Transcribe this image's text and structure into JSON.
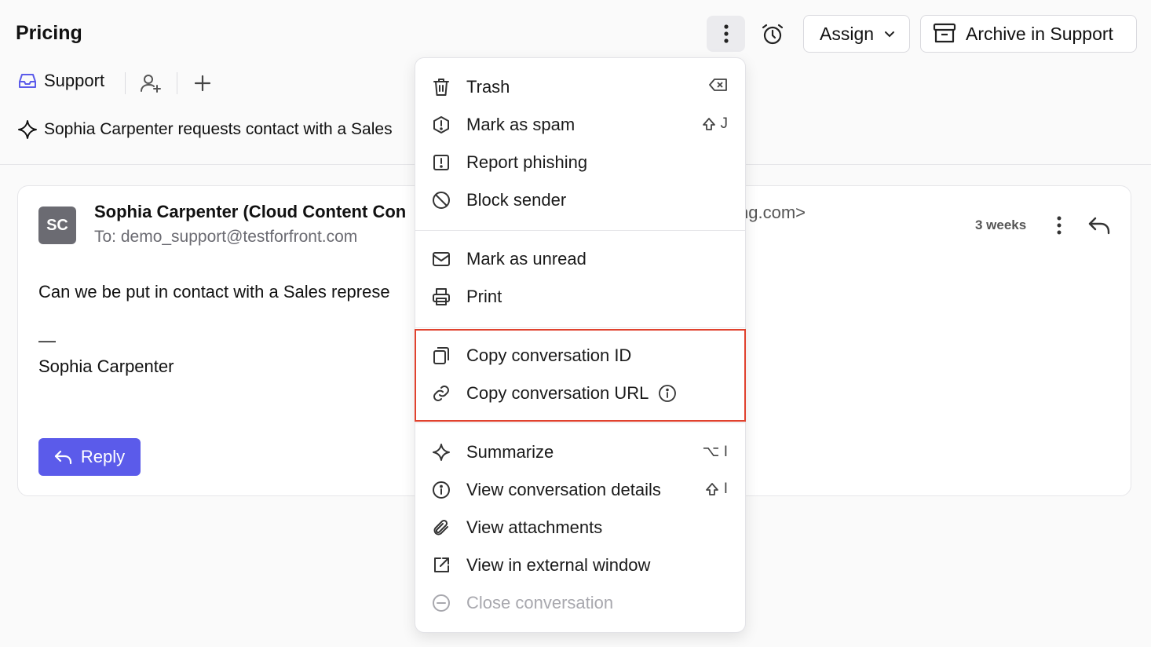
{
  "header": {
    "title": "Pricing",
    "assign_label": "Assign",
    "archive_label": "Archive in Support"
  },
  "inbox": {
    "label": "Support"
  },
  "summary": {
    "text": "Sophia Carpenter requests contact with a Sales"
  },
  "message": {
    "avatar_initials": "SC",
    "sender": "Sophia Carpenter (Cloud Content Con",
    "sender_email_tail": "ng.com>",
    "recipient": "To: demo_support@testforfront.com",
    "timestamp": "3 weeks",
    "body": "Can we be put in contact with a Sales represe",
    "signature_dash": "—",
    "signature_name": "Sophia Carpenter",
    "reply_label": "Reply"
  },
  "menu": {
    "items": [
      {
        "label": "Trash",
        "icon": "trash-icon",
        "shortcut": ""
      },
      {
        "label": "Mark as spam",
        "icon": "spam-icon",
        "shortcut": "J"
      },
      {
        "label": "Report phishing",
        "icon": "phishing-icon",
        "shortcut": ""
      },
      {
        "label": "Block sender",
        "icon": "block-icon",
        "shortcut": ""
      },
      {
        "label": "Mark as unread",
        "icon": "envelope-icon",
        "shortcut": ""
      },
      {
        "label": "Print",
        "icon": "printer-icon",
        "shortcut": ""
      },
      {
        "label": "Copy conversation ID",
        "icon": "copy-icon",
        "shortcut": ""
      },
      {
        "label": "Copy conversation URL",
        "icon": "link-icon",
        "shortcut": ""
      },
      {
        "label": "Summarize",
        "icon": "sparkle-icon",
        "shortcut": "⌥ I"
      },
      {
        "label": "View conversation details",
        "icon": "info-icon",
        "shortcut": "I"
      },
      {
        "label": "View attachments",
        "icon": "paperclip-icon",
        "shortcut": ""
      },
      {
        "label": "View in external window",
        "icon": "external-window-icon",
        "shortcut": ""
      },
      {
        "label": "Close conversation",
        "icon": "close-conversation-icon",
        "shortcut": ""
      }
    ]
  },
  "colors": {
    "accent": "#5b5bea",
    "highlight": "#e0422e",
    "avatar_bg": "#6b6b72"
  }
}
